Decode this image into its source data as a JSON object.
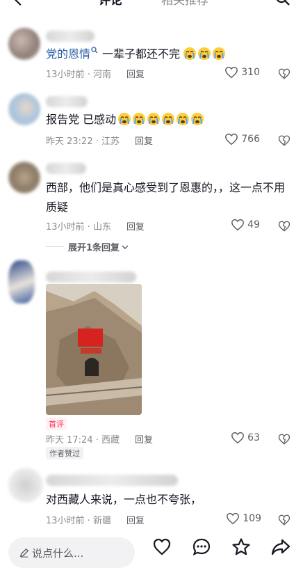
{
  "header": {
    "tab_comments": "评论",
    "tab_related": "相关推荐"
  },
  "comments": [
    {
      "username": "党的恩情",
      "text": "一辈子都还不完",
      "emoji_count": 3,
      "time": "13小时前 · 河南",
      "reply": "回复",
      "likes": "310"
    },
    {
      "text": "报告党 已感动",
      "emoji_count": 6,
      "time": "昨天 23:22 · 江苏",
      "reply": "回复",
      "likes": "766"
    },
    {
      "text": "西部，他们是真心感受到了恩惠的，，这一点不用质疑",
      "time": "13小时前 · 山东",
      "reply": "回复",
      "likes": "49",
      "expand": "展开1条回复"
    },
    {
      "badge_first": "首评",
      "time": "昨天 17:24 · 西藏",
      "reply": "回复",
      "likes": "63",
      "badge_author": "作者赞过"
    },
    {
      "text": "对西藏人来说，一点也不夸张，",
      "time": "13小时前 · 新疆",
      "reply": "回复",
      "likes": "109"
    }
  ],
  "bottom_bar": {
    "placeholder": "说点什么..."
  },
  "colors": {
    "link_blue": "#2b5ea7",
    "accent_red": "#fe2c55",
    "meta_gray": "#8a8b91"
  }
}
